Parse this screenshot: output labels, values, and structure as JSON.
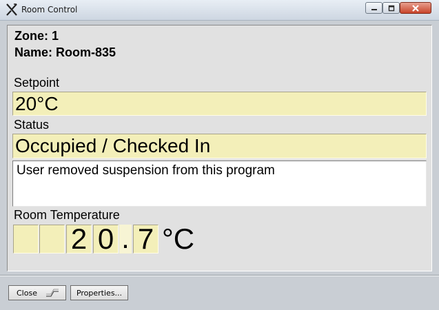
{
  "window": {
    "title": "Room Control",
    "controls": [
      "minimize-icon",
      "maximize-icon",
      "close-icon"
    ]
  },
  "zone": {
    "label": "Zone: 1"
  },
  "room": {
    "label": "Name: Room-835"
  },
  "setpoint": {
    "label": "Setpoint",
    "value": "20°C"
  },
  "status": {
    "label": "Status",
    "value": "Occupied / Checked In",
    "message": "User removed suspension from this program"
  },
  "temperature": {
    "label": "Room Temperature",
    "digits": [
      "",
      "",
      "2",
      "0",
      ".",
      "7"
    ],
    "unit": "°C"
  },
  "footer": {
    "close_label": "Close",
    "close_icon": "shortcut-key-icon",
    "properties_label": "Properties..."
  },
  "colors": {
    "field_bg": "#f3efb9",
    "body_bg": "#e1e1e1",
    "close_button": "#c8442b"
  }
}
